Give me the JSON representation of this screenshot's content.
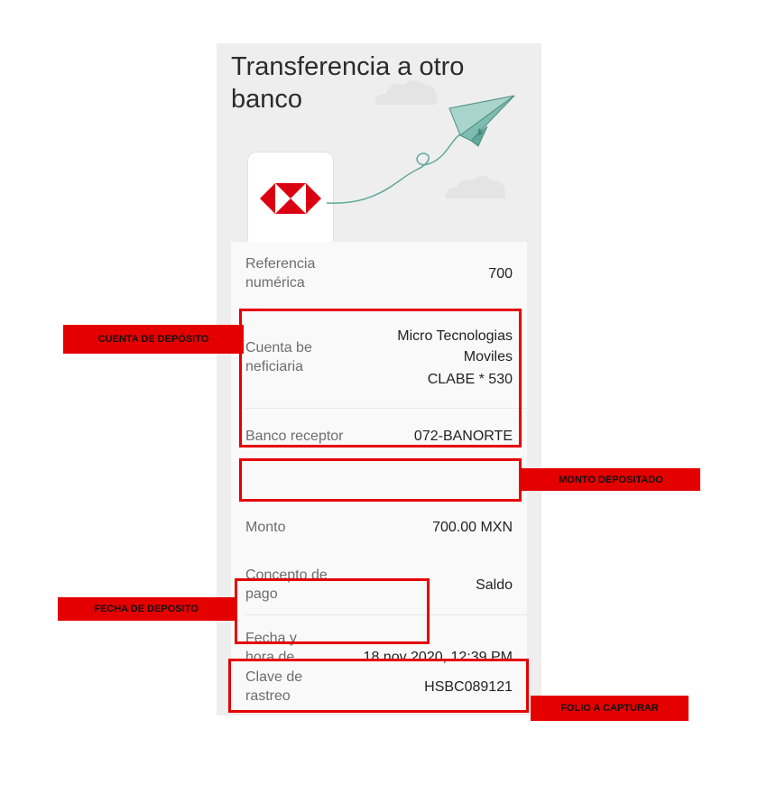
{
  "screen": {
    "title": "Transferencia a otro banco"
  },
  "details": [
    {
      "label": "Referencia numérica",
      "value": "700"
    },
    {
      "label": "Cuenta be neficiaria",
      "value_lines": [
        "Micro Tecnologias",
        "Moviles",
        "CLABE * 530"
      ]
    },
    {
      "label": "Banco receptor",
      "value": "072-BANORTE"
    },
    {
      "label": "Monto",
      "value": "700.00 MXN"
    },
    {
      "label": "Concepto de pago",
      "value": "Saldo"
    },
    {
      "label": "Fecha y hora de operación",
      "value": "18 nov 2020, 12:39 PM"
    },
    {
      "label": "Clave de rastreo",
      "value": "HSBC089121"
    }
  ],
  "annotations": {
    "cuenta": "CUENTA DE DEPÓSITO",
    "monto": "MONTO DEPOSITADO",
    "fecha": "FECHA DE DEPOSITO",
    "folio": "FOLIO A CAPTURAR"
  },
  "colors": {
    "annotation_red": "#e50000",
    "hsbc_red": "#db0011",
    "plane_teal": "#5fa89a"
  },
  "icons": [
    "hsbc-logo-icon",
    "paper-plane-icon",
    "cloud-icon"
  ]
}
